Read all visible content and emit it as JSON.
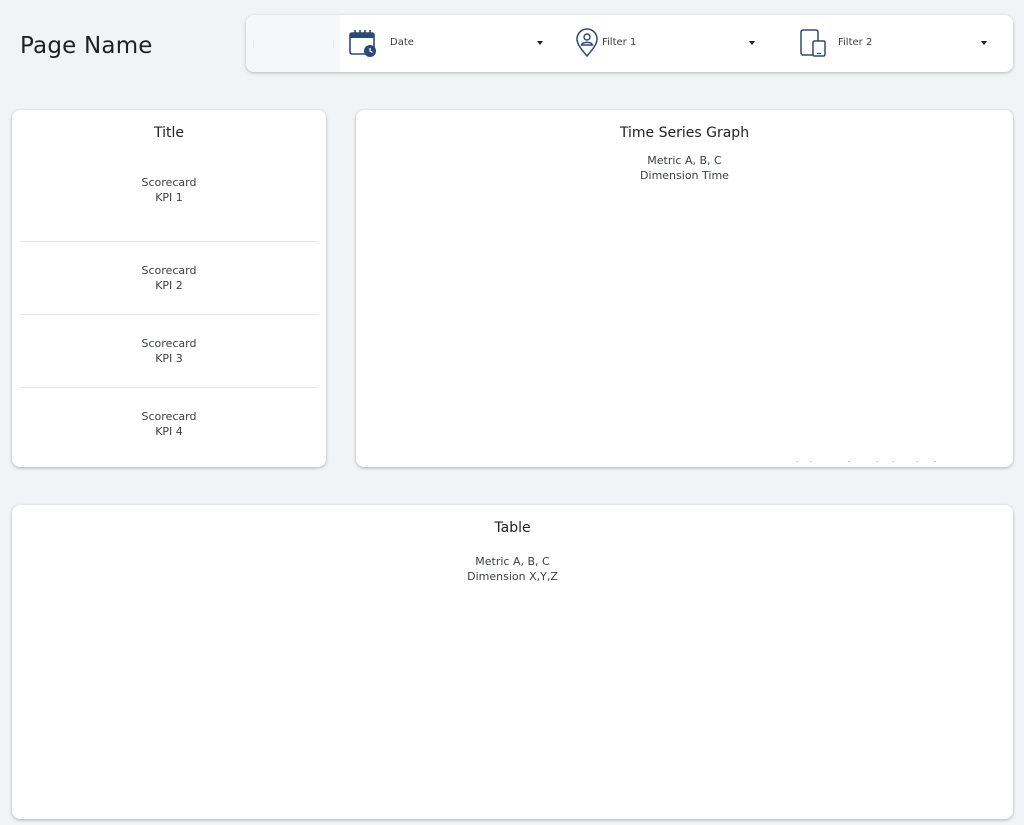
{
  "page": {
    "title": "Page Name"
  },
  "filters": [
    {
      "label": "Date",
      "icon": "calendar-clock-icon"
    },
    {
      "label": "Filter 1",
      "icon": "map-pin-user-icon"
    },
    {
      "label": "Filter 2",
      "icon": "devices-icon"
    }
  ],
  "scorecards": {
    "title": "Title",
    "items": [
      {
        "line1": "Scorecard",
        "line2": "KPI 1"
      },
      {
        "line1": "Scorecard",
        "line2": "KPI 2"
      },
      {
        "line1": "Scorecard",
        "line2": "KPI 3"
      },
      {
        "line1": "Scorecard",
        "line2": "KPI 4"
      }
    ]
  },
  "timeseries": {
    "title": "Time Series Graph",
    "metric": "Metric A, B, C",
    "dimension": "Dimension Time"
  },
  "table": {
    "title": "Table",
    "metric": "Metric A, B, C",
    "dimension": "Dimension X,Y,Z"
  },
  "colors": {
    "icon": "#2b4a73",
    "background": "#f1f3f4",
    "card": "#ffffff"
  }
}
